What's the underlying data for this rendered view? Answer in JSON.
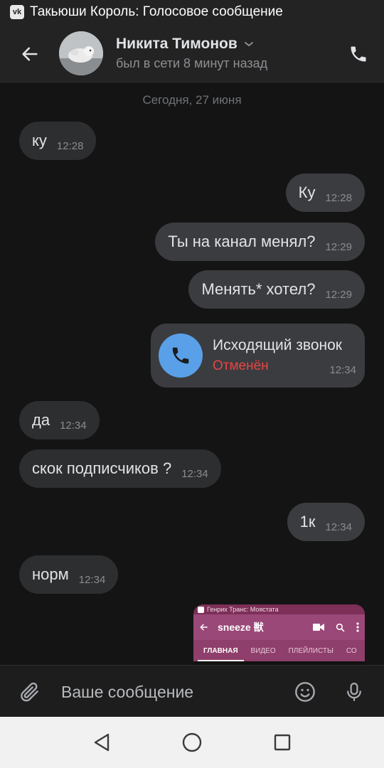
{
  "status_bar": {
    "title": "Такьюши Король: Голосовое сообщение"
  },
  "header": {
    "contact_name": "Никита Тимонов",
    "contact_status": "был в сети 8 минут назад"
  },
  "chat": {
    "date": "Сегодня, 27 июня",
    "messages": [
      {
        "dir": "in",
        "text": "ку",
        "time": "12:28"
      },
      {
        "dir": "out",
        "text": "Ку",
        "time": "12:28"
      },
      {
        "dir": "out",
        "text": "Ты на канал менял?",
        "time": "12:29"
      },
      {
        "dir": "out",
        "text": "Менять* хотел?",
        "time": "12:29"
      },
      {
        "dir": "in",
        "text": "да",
        "time": "12:34"
      },
      {
        "dir": "in",
        "text": "скок подписчиков ?",
        "time": "12:34"
      },
      {
        "dir": "out",
        "text": "1к",
        "time": "12:34"
      },
      {
        "dir": "in",
        "text": "норм",
        "time": "12:34"
      }
    ],
    "call": {
      "title": "Исходящий звонок",
      "status": "Отменён",
      "time": "12:34"
    },
    "preview": {
      "status": "Генрих Транс: Моястата",
      "channel": "sneeze 獣",
      "tabs": [
        "ГЛАВНАЯ",
        "ВИДЕО",
        "ПЛЕЙЛИСТЫ",
        "СО"
      ]
    }
  },
  "input": {
    "placeholder": "Ваше сообщение"
  },
  "colors": {
    "accent": "#5aa0e8",
    "cancelled": "#e64646",
    "bubble_out": "#3b3c3f",
    "bubble_in": "#2d2e30"
  }
}
